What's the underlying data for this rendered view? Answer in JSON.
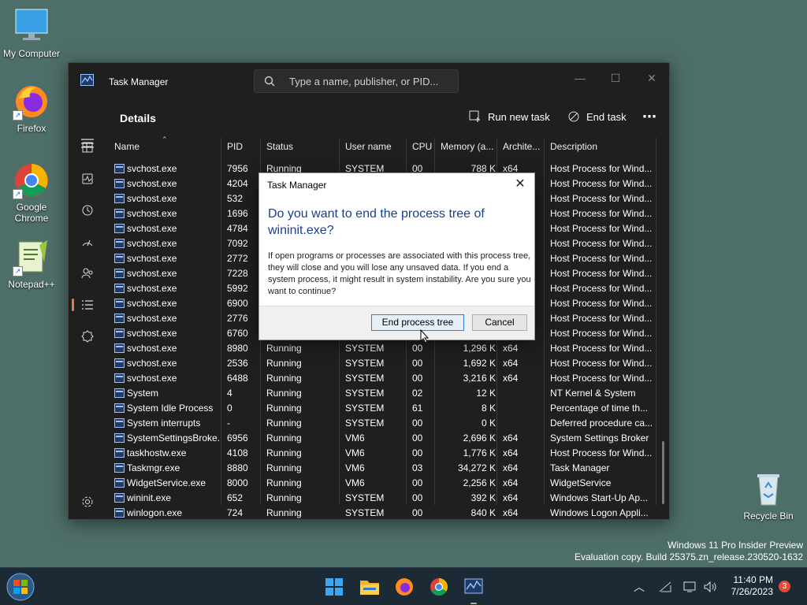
{
  "desktop": {
    "icons": [
      {
        "label": "My Computer",
        "icon": "monitor-icon"
      },
      {
        "label": "Firefox",
        "icon": "firefox-icon"
      },
      {
        "label": "Google Chrome",
        "icon": "chrome-icon"
      },
      {
        "label": "Notepad++",
        "icon": "notepadpp-icon"
      },
      {
        "label": "Recycle Bin",
        "icon": "recycle-bin-icon"
      }
    ],
    "watermark": {
      "line1": "Windows 11 Pro Insider Preview",
      "line2": "Evaluation copy. Build 25375.zn_release.230520-1632"
    }
  },
  "window": {
    "title": "Task Manager",
    "search_placeholder": "Type a name, publisher, or PID...",
    "page_title": "Details",
    "run_new_task": "Run new task",
    "end_task": "End task",
    "columns": [
      "Name",
      "PID",
      "Status",
      "User name",
      "CPU",
      "Memory (a...",
      "Archite...",
      "Description"
    ],
    "rows": [
      [
        "svchost.exe",
        "7956",
        "Running",
        "SYSTEM",
        "00",
        "788 K",
        "x64",
        "Host Process for Wind..."
      ],
      [
        "svchost.exe",
        "4204",
        "",
        "",
        "",
        "",
        "",
        "Host Process for Wind..."
      ],
      [
        "svchost.exe",
        "532",
        "",
        "",
        "",
        "",
        "",
        "Host Process for Wind..."
      ],
      [
        "svchost.exe",
        "1696",
        "",
        "",
        "",
        "",
        "",
        "Host Process for Wind..."
      ],
      [
        "svchost.exe",
        "4784",
        "",
        "",
        "",
        "",
        "",
        "Host Process for Wind..."
      ],
      [
        "svchost.exe",
        "7092",
        "",
        "",
        "",
        "",
        "",
        "Host Process for Wind..."
      ],
      [
        "svchost.exe",
        "2772",
        "",
        "",
        "",
        "",
        "",
        "Host Process for Wind..."
      ],
      [
        "svchost.exe",
        "7228",
        "",
        "",
        "",
        "",
        "",
        "Host Process for Wind..."
      ],
      [
        "svchost.exe",
        "5992",
        "",
        "",
        "",
        "",
        "",
        "Host Process for Wind..."
      ],
      [
        "svchost.exe",
        "6900",
        "",
        "",
        "",
        "",
        "",
        "Host Process for Wind..."
      ],
      [
        "svchost.exe",
        "2776",
        "",
        "",
        "",
        "",
        "",
        "Host Process for Wind..."
      ],
      [
        "svchost.exe",
        "6760",
        "",
        "",
        "",
        "",
        "",
        "Host Process for Wind..."
      ],
      [
        "svchost.exe",
        "8980",
        "Running",
        "SYSTEM",
        "00",
        "1,296 K",
        "x64",
        "Host Process for Wind..."
      ],
      [
        "svchost.exe",
        "2536",
        "Running",
        "SYSTEM",
        "00",
        "1,692 K",
        "x64",
        "Host Process for Wind..."
      ],
      [
        "svchost.exe",
        "6488",
        "Running",
        "SYSTEM",
        "00",
        "3,216 K",
        "x64",
        "Host Process for Wind..."
      ],
      [
        "System",
        "4",
        "Running",
        "SYSTEM",
        "02",
        "12 K",
        "",
        "NT Kernel & System"
      ],
      [
        "System Idle Process",
        "0",
        "Running",
        "SYSTEM",
        "61",
        "8 K",
        "",
        "Percentage of time th..."
      ],
      [
        "System interrupts",
        "-",
        "Running",
        "SYSTEM",
        "00",
        "0 K",
        "",
        "Deferred procedure ca..."
      ],
      [
        "SystemSettingsBroke...",
        "6956",
        "Running",
        "VM6",
        "00",
        "2,696 K",
        "x64",
        "System Settings Broker"
      ],
      [
        "taskhostw.exe",
        "4108",
        "Running",
        "VM6",
        "00",
        "1,776 K",
        "x64",
        "Host Process for Wind..."
      ],
      [
        "Taskmgr.exe",
        "8880",
        "Running",
        "VM6",
        "03",
        "34,272 K",
        "x64",
        "Task Manager"
      ],
      [
        "WidgetService.exe",
        "8000",
        "Running",
        "VM6",
        "00",
        "2,256 K",
        "x64",
        "WidgetService"
      ],
      [
        "wininit.exe",
        "652",
        "Running",
        "SYSTEM",
        "00",
        "392 K",
        "x64",
        "Windows Start-Up Ap..."
      ],
      [
        "winlogon.exe",
        "724",
        "Running",
        "SYSTEM",
        "00",
        "840 K",
        "x64",
        "Windows Logon Appli..."
      ]
    ]
  },
  "dialog": {
    "title": "Task Manager",
    "heading": "Do you want to end the process tree of wininit.exe?",
    "body": "If open programs or processes are associated with this process tree, they will close and you will lose any unsaved data. If you end a system process, it might result in system instability. Are you sure you want to continue?",
    "confirm": "End process tree",
    "cancel": "Cancel"
  },
  "taskbar": {
    "time": "11:40 PM",
    "date": "7/26/2023",
    "notifications": "3"
  }
}
